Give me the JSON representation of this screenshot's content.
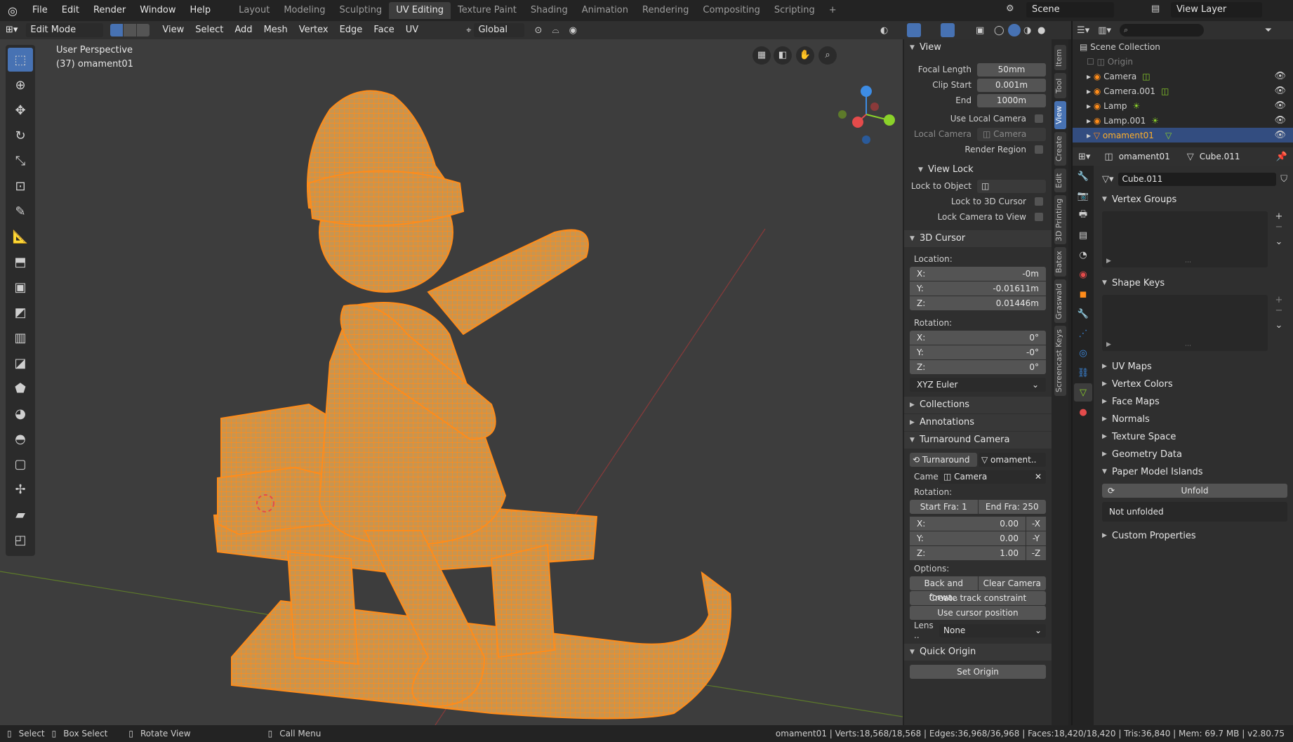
{
  "menu": [
    "File",
    "Edit",
    "Render",
    "Window",
    "Help"
  ],
  "workspaces": [
    "Layout",
    "Modeling",
    "Sculpting",
    "UV Editing",
    "Texture Paint",
    "Shading",
    "Animation",
    "Rendering",
    "Compositing",
    "Scripting"
  ],
  "active_workspace_index": 3,
  "scene": "Scene",
  "view_layer": "View Layer",
  "header": {
    "mode": "Edit Mode",
    "menus": [
      "View",
      "Select",
      "Add",
      "Mesh",
      "Vertex",
      "Edge",
      "Face",
      "UV"
    ],
    "transform_orientation": "Global"
  },
  "viewport": {
    "perspective": "User Perspective",
    "object_label": "(37) omament01"
  },
  "npanel": {
    "view_title": "View",
    "focal_length_label": "Focal Length",
    "focal_length": "50mm",
    "clip_start_label": "Clip Start",
    "clip_start": "0.001m",
    "clip_end_label": "End",
    "clip_end": "1000m",
    "use_local_camera": "Use Local Camera",
    "local_camera_label": "Local Camera",
    "local_camera": "Camera",
    "render_region": "Render Region",
    "view_lock_title": "View Lock",
    "lock_to_object": "Lock to Object",
    "lock_to_cursor": "Lock to 3D Cursor",
    "lock_camera": "Lock Camera to View",
    "cursor_title": "3D Cursor",
    "location_label": "Location:",
    "loc": [
      {
        "axis": "X:",
        "val": "-0m"
      },
      {
        "axis": "Y:",
        "val": "-0.01611m"
      },
      {
        "axis": "Z:",
        "val": "0.01446m"
      }
    ],
    "rotation_label": "Rotation:",
    "rot": [
      {
        "axis": "X:",
        "val": "0°"
      },
      {
        "axis": "Y:",
        "val": "-0°"
      },
      {
        "axis": "Z:",
        "val": "0°"
      }
    ],
    "rot_mode": "XYZ Euler",
    "collections": "Collections",
    "annotations": "Annotations",
    "turnaround_title": "Turnaround Camera",
    "turnaround_btn": "Turnaround",
    "turnaround_obj": "omament..",
    "camera_label": "Came..",
    "camera_val": "Camera",
    "rotation2_label": "Rotation:",
    "start_frame": "Start Fra: 1",
    "end_frame": "End Fra: 250",
    "rot2": [
      {
        "axis": "X:",
        "val": "0.00",
        "neg": "-X"
      },
      {
        "axis": "Y:",
        "val": "0.00",
        "neg": "-Y"
      },
      {
        "axis": "Z:",
        "val": "1.00",
        "neg": "-Z"
      }
    ],
    "options_label": "Options:",
    "back_forward": "Back and forwa..",
    "clear_camera": "Clear Camera",
    "create_track": "Create track constraint",
    "use_cursor": "Use cursor position",
    "lens_label": "Lens ..",
    "lens_val": "None",
    "quick_origin_title": "Quick Origin",
    "set_origin": "Set Origin"
  },
  "vtabs": [
    "Item",
    "Tool",
    "View",
    "Create",
    "Edit",
    "3D Printing",
    "Batex",
    "Graswald",
    "Screencast Keys"
  ],
  "active_vtab": "View",
  "outliner": {
    "root": "Scene Collection",
    "items": [
      {
        "name": "Origin",
        "dim": true
      },
      {
        "name": "Camera",
        "dim": false
      },
      {
        "name": "Camera.001",
        "dim": false
      },
      {
        "name": "Lamp",
        "dim": false
      },
      {
        "name": "Lamp.001",
        "dim": false
      },
      {
        "name": "omament01",
        "dim": false,
        "active": true
      }
    ]
  },
  "properties": {
    "object": "omament01",
    "mesh": "Cube.011",
    "mesh_field": "Cube.011",
    "sections": [
      "Vertex Groups",
      "Shape Keys",
      "UV Maps",
      "Vertex Colors",
      "Face Maps",
      "Normals",
      "Texture Space",
      "Geometry Data",
      "Paper Model Islands",
      "Custom Properties"
    ],
    "unfold": "Unfold",
    "not_unfolded": "Not unfolded"
  },
  "status": {
    "select": "Select",
    "box_select": "Box Select",
    "rotate_view": "Rotate View",
    "call_menu": "Call Menu",
    "stats": "omament01 | Verts:18,568/18,568 | Edges:36,968/36,968 | Faces:18,420/18,420 | Tris:36,840 | Mem: 69.7 MB | v2.80.75"
  },
  "colors": {
    "accent": "#4772b3",
    "mesh_orange": "#ff8c1a",
    "x_axis": "#e44b4b",
    "y_axis": "#8bd22a",
    "z_axis": "#3d8ce4"
  }
}
